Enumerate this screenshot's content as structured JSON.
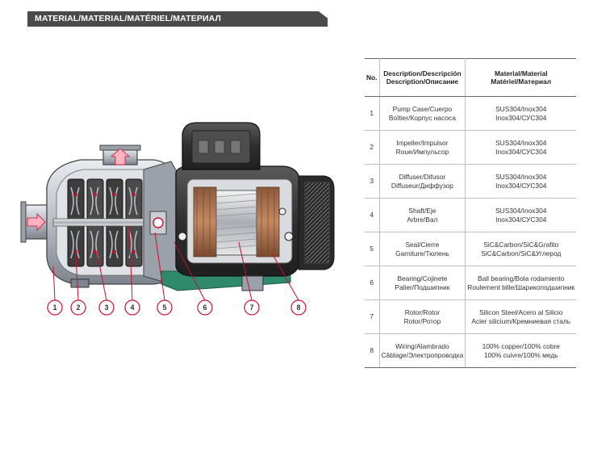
{
  "header": {
    "title": "MATERIAL/MATERIAL/MATÉRIEL/МАТЕРИАЛ"
  },
  "diagram": {
    "callouts": [
      "1",
      "2",
      "3",
      "4",
      "5",
      "6",
      "7",
      "8"
    ],
    "colors": {
      "accent": "#c8102e",
      "body": "#3c3c3c",
      "base": "#2e8a6b"
    }
  },
  "table": {
    "headers": {
      "no": "No.",
      "description": [
        "Description/Descripción",
        "Description/Описание"
      ],
      "material": [
        "Material/Material",
        "Matériel/Материал"
      ]
    },
    "rows": [
      {
        "no": "1",
        "description": [
          "Pump Case/Cuerpo",
          "Boîtier/Корпус насоса"
        ],
        "material": [
          "SUS304/Inox304",
          "Inox304/СУС304"
        ]
      },
      {
        "no": "2",
        "description": [
          "Impeller/Impulsor",
          "Roue/Импульсор"
        ],
        "material": [
          "SUS304/Inox304",
          "Inox304/СУС304"
        ]
      },
      {
        "no": "3",
        "description": [
          "Diffuser/Difusor",
          "Diffuseur/Диффузор"
        ],
        "material": [
          "SUS304/Inox304",
          "Inox304/СУС304"
        ]
      },
      {
        "no": "4",
        "description": [
          "Shaft/Eje",
          "Arbre/Вал"
        ],
        "material": [
          "SUS304/Inox304",
          "Inox304/СУС304"
        ]
      },
      {
        "no": "5",
        "description": [
          "Seal/Cierre",
          "Garniture/Тюлень"
        ],
        "material": [
          "SiC&Carbon/SiC&Grafito",
          "SiC&Carbon/SiC&Углерод"
        ]
      },
      {
        "no": "6",
        "description": [
          "Bearing/Cojinete",
          "Palier/Подшипник"
        ],
        "material": [
          "Ball bearing/Bola rodamiento",
          "Roulement bille/Шарикоподшипник"
        ]
      },
      {
        "no": "7",
        "description": [
          "Rotor/Rotor",
          "Rotor/Ротор"
        ],
        "material": [
          "Silicon Steel/Acero al Silicio",
          "Acier silicium/Кремниевая сталь"
        ]
      },
      {
        "no": "8",
        "description": [
          "Wiring/Alambrado",
          "Câblage/Электропроводка"
        ],
        "material": [
          "100% copper/100% cobre",
          "100% cuivre/100% медь"
        ]
      }
    ]
  }
}
